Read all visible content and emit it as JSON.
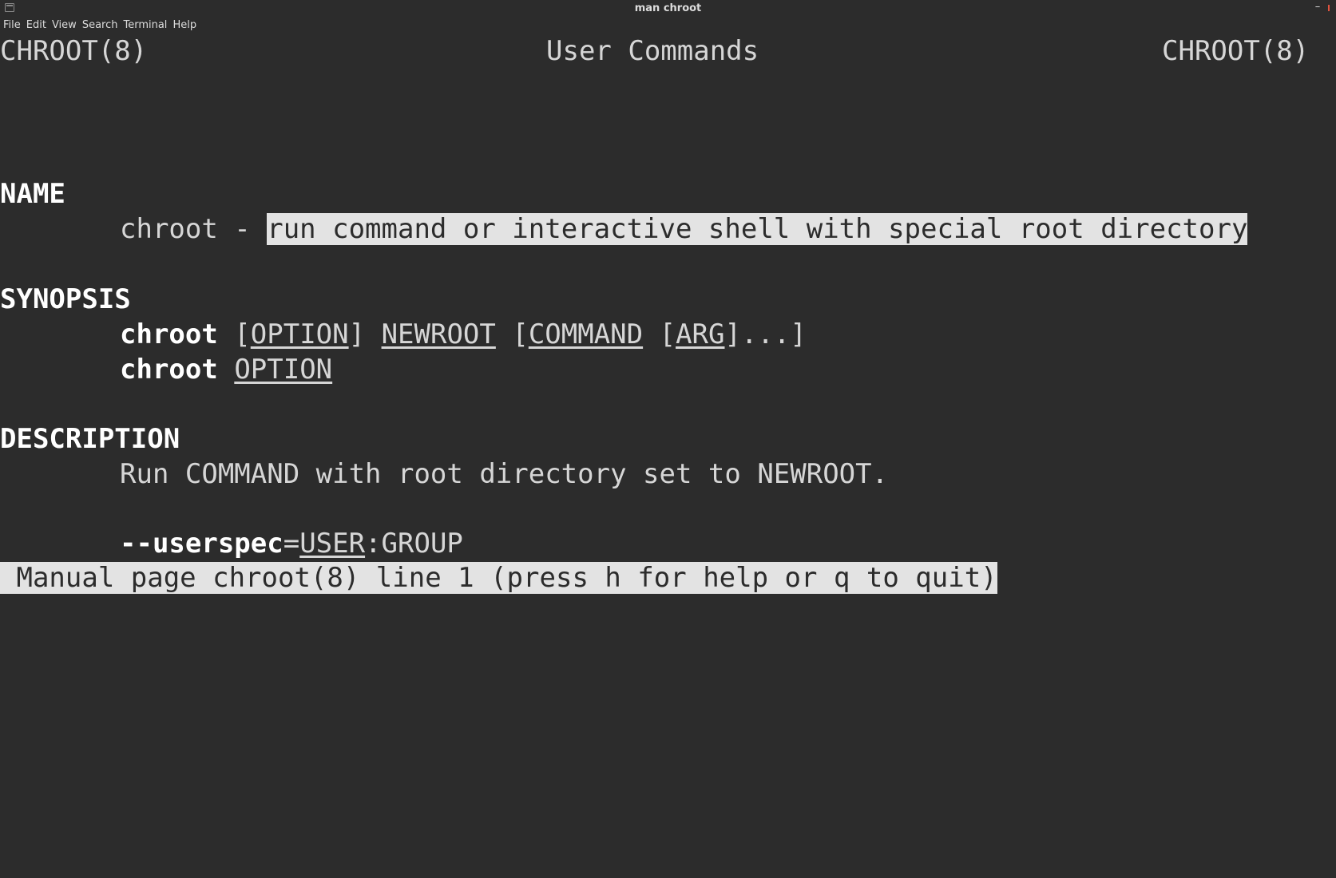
{
  "window": {
    "title": "man chroot",
    "minimize_glyph": "–"
  },
  "menu": [
    "File",
    "Edit",
    "View",
    "Search",
    "Terminal",
    "Help"
  ],
  "header": {
    "left": "CHROOT(8)",
    "center": "User Commands",
    "right": "CHROOT(8)"
  },
  "sections": {
    "name_heading": "NAME",
    "name_prefix": "chroot - ",
    "name_desc": "run command or interactive shell with special root directory",
    "synopsis_heading": "SYNOPSIS",
    "syn1": {
      "cmd": "chroot",
      "sp1": " [",
      "opt": "OPTION",
      "sp2": "] ",
      "newroot": "NEWROOT",
      "sp3": " [",
      "command": "COMMAND",
      "sp4": " [",
      "arg": "ARG",
      "tail": "]...]"
    },
    "syn2": {
      "cmd": "chroot",
      "sp": " ",
      "opt": "OPTION"
    },
    "description_heading": "DESCRIPTION",
    "description_text": "Run COMMAND with root directory set to NEWROOT.",
    "userspec": {
      "flag": "--userspec",
      "eq": "=",
      "user": "USER",
      "rest": ":GROUP"
    }
  },
  "status_line": " Manual page chroot(8) line 1 (press h for help or q to quit)",
  "colors": {
    "background": "#2c2c2c",
    "foreground": "#d6d6d6",
    "bold": "#ffffff",
    "highlight_bg": "#e3e3e3",
    "close_accent": "#e0533f"
  }
}
